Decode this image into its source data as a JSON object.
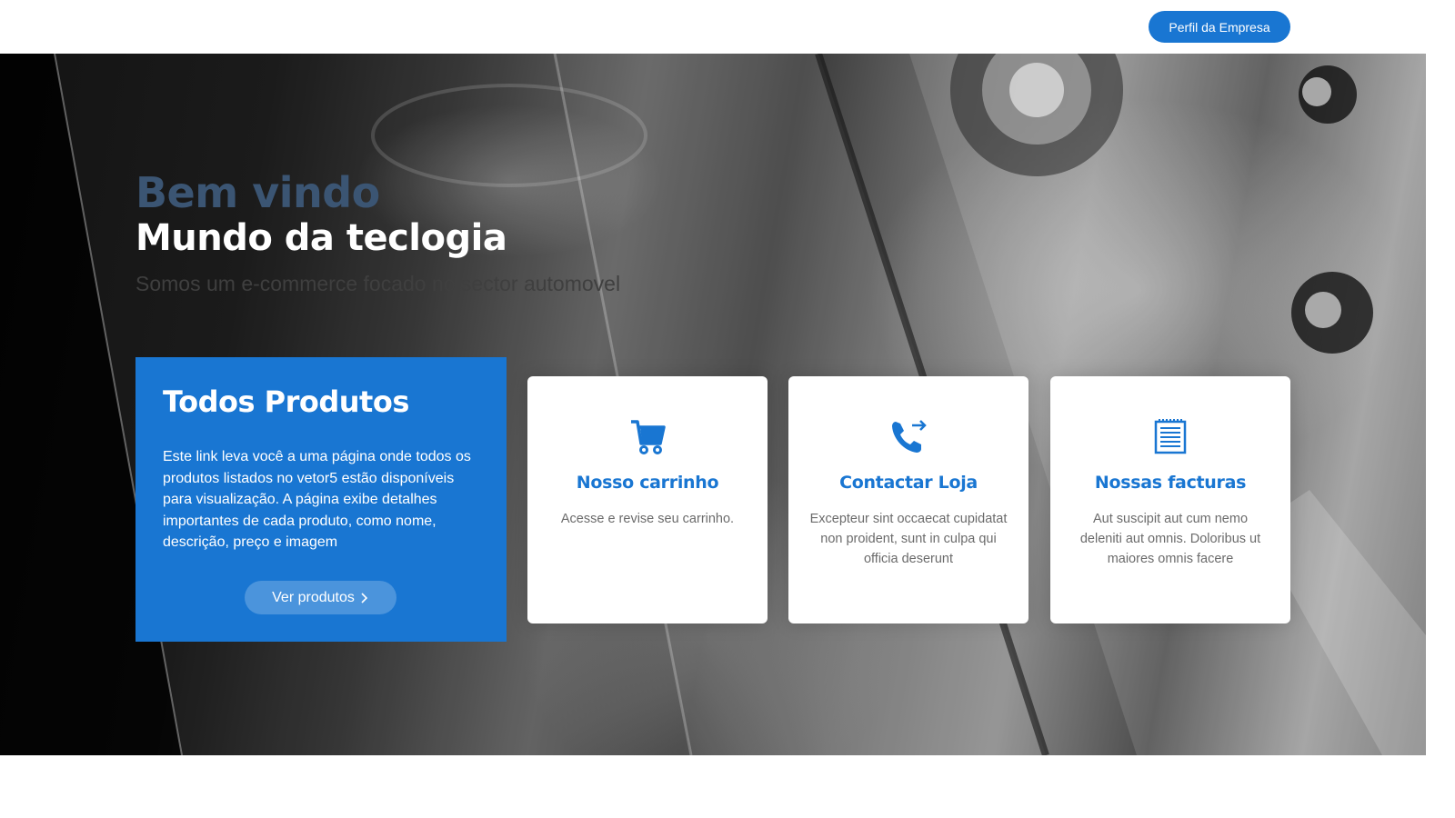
{
  "header": {
    "company_profile_label": "Perfil da Empresa"
  },
  "hero": {
    "title_line1": "Bem vindo",
    "title_line2": "Mundo da teclogia",
    "subtitle": "Somos um e-commerce focado no sector automovel"
  },
  "promo": {
    "title": "Todos Produtos",
    "text": "Este link leva você a uma página onde todos os produtos listados no vetor5 estão disponíveis para visualização. A página exibe detalhes importantes de cada produto, como nome, descrição, preço e imagem",
    "button_label": "Ver produtos"
  },
  "cards": [
    {
      "icon": "cart-icon",
      "title": "Nosso carrinho",
      "text": "Acesse e revise seu carrinho."
    },
    {
      "icon": "phone-forward-icon",
      "title": "Contactar Loja",
      "text": "Excepteur sint occaecat cupidatat non proident, sunt in culpa qui officia deserunt"
    },
    {
      "icon": "invoice-icon",
      "title": "Nossas facturas",
      "text": "Aut suscipit aut cum nemo deleniti aut omnis. Doloribus ut maiores omnis facere"
    }
  ],
  "colors": {
    "brand": "#1976d2",
    "title_dark": "#3b5573",
    "text_muted": "#6b6b6b"
  }
}
